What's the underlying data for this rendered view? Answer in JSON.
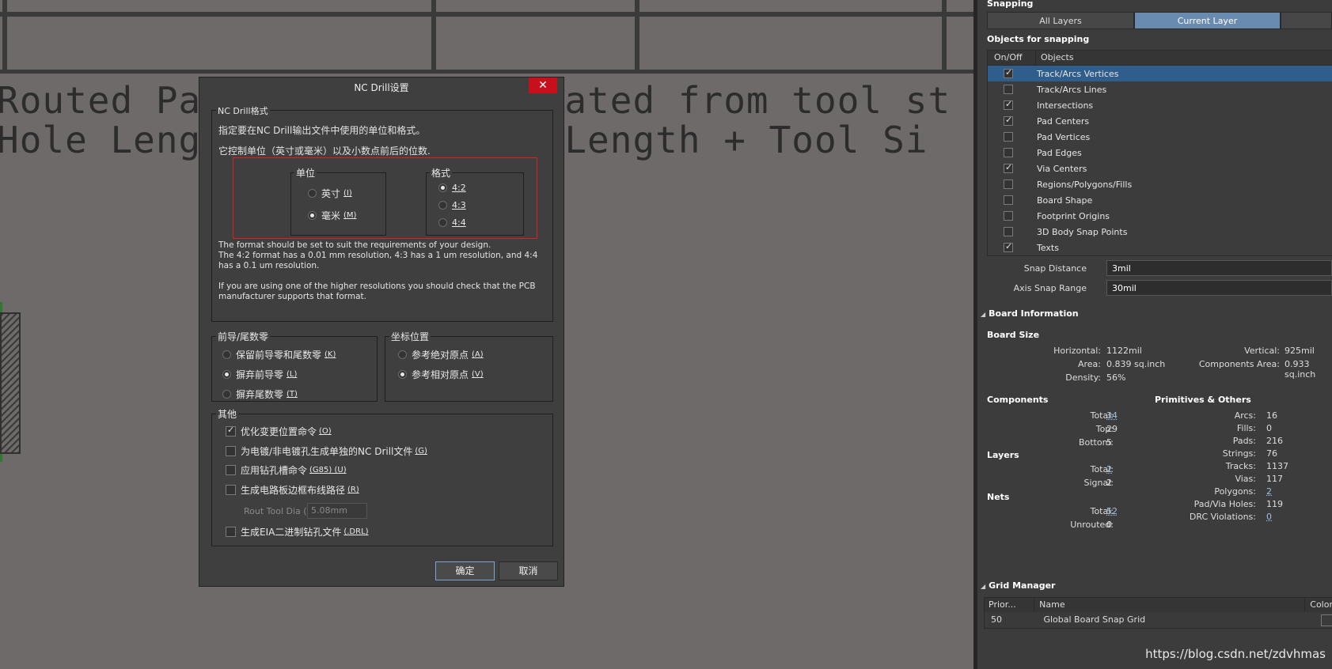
{
  "canvas": {
    "line1": "Routed Pa              ulated from tool st",
    "line2": "Hole Leng              h Length + Tool Si"
  },
  "panel": {
    "snapping_header": "Snapping",
    "seg_all": "All Layers",
    "seg_current": "Current Layer",
    "objects_header": "Objects for snapping",
    "col_onoff": "On/Off",
    "col_objects": "Objects",
    "objects": [
      {
        "label": "Track/Arcs Vertices",
        "on": true,
        "selected": true
      },
      {
        "label": "Track/Arcs Lines",
        "on": false,
        "selected": false
      },
      {
        "label": "Intersections",
        "on": true,
        "selected": false
      },
      {
        "label": "Pad Centers",
        "on": true,
        "selected": false
      },
      {
        "label": "Pad Vertices",
        "on": false,
        "selected": false
      },
      {
        "label": "Pad Edges",
        "on": false,
        "selected": false
      },
      {
        "label": "Via Centers",
        "on": true,
        "selected": false
      },
      {
        "label": "Regions/Polygons/Fills",
        "on": false,
        "selected": false
      },
      {
        "label": "Board Shape",
        "on": false,
        "selected": false
      },
      {
        "label": "Footprint Origins",
        "on": false,
        "selected": false
      },
      {
        "label": "3D Body Snap Points",
        "on": false,
        "selected": false
      },
      {
        "label": "Texts",
        "on": true,
        "selected": false
      }
    ],
    "snap_distance_label": "Snap Distance",
    "snap_distance_value": "3mil",
    "axis_snap_label": "Axis Snap Range",
    "axis_snap_value": "30mil",
    "board_info_header": "Board Information",
    "board_size_header": "Board Size",
    "horizontal_label": "Horizontal:",
    "horizontal_value": "1122mil",
    "vertical_label": "Vertical:",
    "vertical_value": "925mil",
    "area_label": "Area:",
    "area_value": "0.839 sq.inch",
    "comp_area_label": "Components Area:",
    "comp_area_value": "0.933 sq.inch",
    "density_label": "Density:",
    "density_value": "56%",
    "components_header": "Components",
    "prims_header": "Primitives & Others",
    "comp_total_label": "Total:",
    "comp_total_value": "34",
    "comp_top_label": "Top:",
    "comp_top_value": "29",
    "comp_bottom_label": "Bottom:",
    "comp_bottom_value": "5",
    "layers_header": "Layers",
    "layers_total_label": "Total:",
    "layers_total_value": "2",
    "layers_signal_label": "Signal:",
    "layers_signal_value": "2",
    "nets_header": "Nets",
    "nets_total_label": "Total:",
    "nets_total_value": "52",
    "nets_unrouted_label": "Unrouted:",
    "nets_unrouted_value": "0",
    "prims": [
      {
        "k": "Arcs:",
        "v": "16",
        "link": false
      },
      {
        "k": "Fills:",
        "v": "0",
        "link": false
      },
      {
        "k": "Pads:",
        "v": "216",
        "link": false
      },
      {
        "k": "Strings:",
        "v": "76",
        "link": false
      },
      {
        "k": "Tracks:",
        "v": "1137",
        "link": false
      },
      {
        "k": "Vias:",
        "v": "117",
        "link": false
      },
      {
        "k": "Polygons:",
        "v": "2",
        "link": true
      },
      {
        "k": "Pad/Via Holes:",
        "v": "119",
        "link": false
      },
      {
        "k": "DRC Violations:",
        "v": "0",
        "link": true
      }
    ],
    "grid_header": "Grid Manager",
    "grid_col_prior": "Prior...",
    "grid_col_name": "Name",
    "grid_col_color": "Color",
    "grid_row_prior": "50",
    "grid_row_name": "Global Board Snap Grid"
  },
  "dialog": {
    "title": "NC Drill设置",
    "close": "✕",
    "fmt_group": "NC Drill格式",
    "desc1": "指定要在NC Drill输出文件中使用的单位和格式。",
    "desc2": "它控制单位（英寸或毫米）以及小数点前后的位数.",
    "units_group": "单位",
    "unit_inch": "英寸",
    "unit_inch_sc": "(I)",
    "unit_mm": "毫米",
    "unit_mm_sc": "(M)",
    "format_group": "格式",
    "f42": "4:2",
    "f43": "4:3",
    "f44": "4:4",
    "note1": "The format should be set to suit the requirements of your design.",
    "note2": "The 4:2 format has a 0.01 mm resolution, 4:3 has a 1 um resolution, and 4:4 has a 0.1 um resolution.",
    "note3": "If you are using one of the higher resolutions you should check that the PCB manufacturer supports that format.",
    "zeros_group": "前导/尾数零",
    "z_keep": "保留前导零和尾数零",
    "z_keep_sc": "(K)",
    "z_lead": "摒弃前导零",
    "z_lead_sc": "(L)",
    "z_trail": "摒弃尾数零",
    "z_trail_sc": "(T)",
    "coord_group": "坐标位置",
    "c_abs": "参考绝对原点",
    "c_abs_sc": "(A)",
    "c_rel": "参考相对原点",
    "c_rel_sc": "(V)",
    "other_group": "其他",
    "o1": "优化变更位置命令",
    "o1_sc": "(O)",
    "o2": "为电镀/非电镀孔生成单独的NC Drill文件",
    "o2_sc": "(G)",
    "o3": "应用钻孔槽命令",
    "o3_sc": "(G85) (U)",
    "o4": "生成电路板边框布线路径",
    "o4_sc": "(R)",
    "rout_label": "Rout Tool  Dia (",
    "rout_value": "5.08mm",
    "o5": "生成EIA二进制钻孔文件",
    "o5_sc": "(.DRL)",
    "ok": "确定",
    "cancel": "取消"
  },
  "watermark": "https://blog.csdn.net/zdvhmas"
}
